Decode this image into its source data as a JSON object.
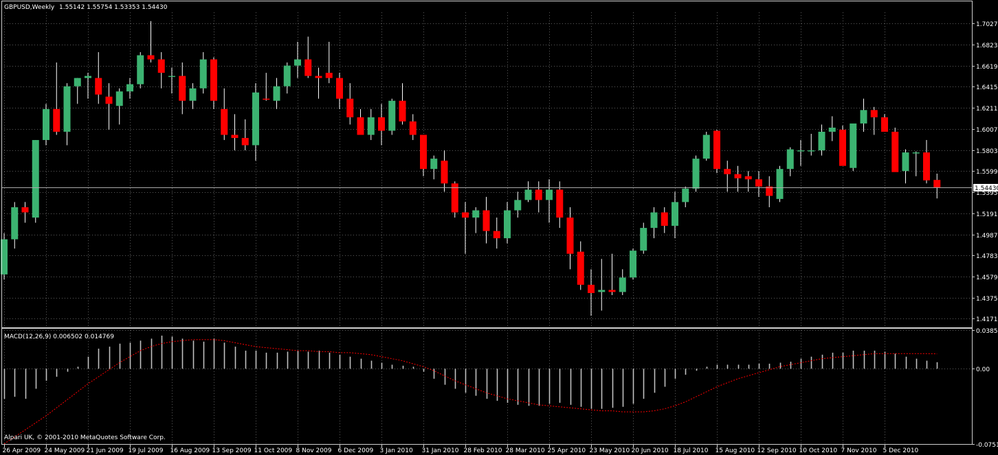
{
  "header": {
    "symbol_label": "GBPUSD,Weekly",
    "ohlc_label": "1.55142 1.55754 1.53353 1.54430"
  },
  "macd_panel": {
    "label": "MACD(12,26,9) 0.006502 0.014769"
  },
  "footer": {
    "broker_label": "Alpari UK, © 2001-2010 MetaQuotes Software Corp."
  },
  "colors": {
    "background": "#000000",
    "grid": "#5c5c5c",
    "bull_candle": "#3cb371",
    "bear_candle": "#ff0000",
    "wick": "#ffffff",
    "histogram": "#c0c0c0",
    "signal_line": "#ff0000",
    "last_price_line": "#aaaaaa"
  },
  "chart_data": [
    {
      "type": "candlestick",
      "symbol": "GBPUSD",
      "timeframe": "Weekly",
      "current_price": 1.5443,
      "current_price_label": "1.54430",
      "ylim": [
        1.4088,
        1.7135
      ],
      "y_ticks": [
        "1.70270",
        "1.68230",
        "1.66190",
        "1.64150",
        "1.62110",
        "1.60070",
        "1.58030",
        "1.55990",
        "1.53950",
        "1.51910",
        "1.49870",
        "1.47830",
        "1.45790",
        "1.43750",
        "1.41710"
      ],
      "x_ticks": [
        {
          "index": 0,
          "label": "26 Apr 2009"
        },
        {
          "index": 4,
          "label": "24 May 2009"
        },
        {
          "index": 8,
          "label": "21 Jun 2009"
        },
        {
          "index": 12,
          "label": "19 Jul 2009"
        },
        {
          "index": 16,
          "label": "16 Aug 2009"
        },
        {
          "index": 20,
          "label": "13 Sep 2009"
        },
        {
          "index": 24,
          "label": "11 Oct 2009"
        },
        {
          "index": 28,
          "label": "8 Nov 2009"
        },
        {
          "index": 32,
          "label": "6 Dec 2009"
        },
        {
          "index": 36,
          "label": "3 Jan 2010"
        },
        {
          "index": 40,
          "label": "31 Jan 2010"
        },
        {
          "index": 44,
          "label": "28 Feb 2010"
        },
        {
          "index": 48,
          "label": "28 Mar 2010"
        },
        {
          "index": 52,
          "label": "25 Apr 2010"
        },
        {
          "index": 56,
          "label": "23 May 2010"
        },
        {
          "index": 60,
          "label": "20 Jun 2010"
        },
        {
          "index": 64,
          "label": "18 Jul 2010"
        },
        {
          "index": 68,
          "label": "15 Aug 2010"
        },
        {
          "index": 72,
          "label": "12 Sep 2010"
        },
        {
          "index": 76,
          "label": "10 Oct 2010"
        },
        {
          "index": 80,
          "label": "7 Nov 2010"
        },
        {
          "index": 84,
          "label": "5 Dec 2010"
        }
      ],
      "ohlc": [
        [
          1.46,
          1.5,
          1.455,
          1.494
        ],
        [
          1.494,
          1.53,
          1.485,
          1.525
        ],
        [
          1.525,
          1.53,
          1.51,
          1.52
        ],
        [
          1.515,
          1.59,
          1.51,
          1.59
        ],
        [
          1.59,
          1.625,
          1.585,
          1.62
        ],
        [
          1.62,
          1.665,
          1.595,
          1.598
        ],
        [
          1.598,
          1.645,
          1.585,
          1.642
        ],
        [
          1.642,
          1.65,
          1.625,
          1.65
        ],
        [
          1.65,
          1.655,
          1.63,
          1.652
        ],
        [
          1.65,
          1.675,
          1.625,
          1.634
        ],
        [
          1.632,
          1.645,
          1.6,
          1.625
        ],
        [
          1.623,
          1.64,
          1.605,
          1.637
        ],
        [
          1.637,
          1.65,
          1.63,
          1.644
        ],
        [
          1.644,
          1.675,
          1.64,
          1.672
        ],
        [
          1.672,
          1.705,
          1.665,
          1.668
        ],
        [
          1.668,
          1.675,
          1.64,
          1.655
        ],
        [
          1.652,
          1.66,
          1.635,
          1.652
        ],
        [
          1.652,
          1.665,
          1.615,
          1.628
        ],
        [
          1.628,
          1.645,
          1.62,
          1.64
        ],
        [
          1.64,
          1.675,
          1.635,
          1.668
        ],
        [
          1.668,
          1.67,
          1.62,
          1.628
        ],
        [
          1.62,
          1.64,
          1.59,
          1.595
        ],
        [
          1.595,
          1.615,
          1.58,
          1.592
        ],
        [
          1.592,
          1.61,
          1.58,
          1.585
        ],
        [
          1.585,
          1.645,
          1.57,
          1.636
        ],
        [
          1.63,
          1.655,
          1.628,
          1.629
        ],
        [
          1.628,
          1.65,
          1.62,
          1.642
        ],
        [
          1.642,
          1.665,
          1.635,
          1.662
        ],
        [
          1.662,
          1.685,
          1.65,
          1.668
        ],
        [
          1.668,
          1.69,
          1.65,
          1.652
        ],
        [
          1.652,
          1.66,
          1.63,
          1.65
        ],
        [
          1.655,
          1.685,
          1.645,
          1.65
        ],
        [
          1.65,
          1.655,
          1.62,
          1.63
        ],
        [
          1.63,
          1.645,
          1.605,
          1.612
        ],
        [
          1.612,
          1.62,
          1.595,
          1.595
        ],
        [
          1.595,
          1.62,
          1.59,
          1.612
        ],
        [
          1.612,
          1.625,
          1.585,
          1.599
        ],
        [
          1.599,
          1.63,
          1.595,
          1.628
        ],
        [
          1.628,
          1.645,
          1.605,
          1.608
        ],
        [
          1.608,
          1.615,
          1.59,
          1.595
        ],
        [
          1.595,
          1.595,
          1.555,
          1.562
        ],
        [
          1.562,
          1.575,
          1.552,
          1.572
        ],
        [
          1.57,
          1.58,
          1.54,
          1.548
        ],
        [
          1.548,
          1.55,
          1.515,
          1.52
        ],
        [
          1.52,
          1.53,
          1.48,
          1.515
        ],
        [
          1.515,
          1.525,
          1.5,
          1.522
        ],
        [
          1.522,
          1.535,
          1.49,
          1.502
        ],
        [
          1.502,
          1.515,
          1.485,
          1.495
        ],
        [
          1.495,
          1.53,
          1.49,
          1.522
        ],
        [
          1.522,
          1.54,
          1.515,
          1.532
        ],
        [
          1.532,
          1.55,
          1.53,
          1.542
        ],
        [
          1.542,
          1.55,
          1.52,
          1.532
        ],
        [
          1.532,
          1.552,
          1.51,
          1.542
        ],
        [
          1.542,
          1.55,
          1.505,
          1.515
        ],
        [
          1.515,
          1.525,
          1.465,
          1.48
        ],
        [
          1.482,
          1.492,
          1.445,
          1.45
        ],
        [
          1.45,
          1.465,
          1.42,
          1.442
        ],
        [
          1.443,
          1.475,
          1.425,
          1.445
        ],
        [
          1.445,
          1.48,
          1.44,
          1.443
        ],
        [
          1.443,
          1.465,
          1.44,
          1.457
        ],
        [
          1.457,
          1.485,
          1.455,
          1.483
        ],
        [
          1.483,
          1.51,
          1.48,
          1.505
        ],
        [
          1.505,
          1.525,
          1.495,
          1.52
        ],
        [
          1.52,
          1.525,
          1.5,
          1.507
        ],
        [
          1.507,
          1.54,
          1.495,
          1.53
        ],
        [
          1.53,
          1.545,
          1.525,
          1.543
        ],
        [
          1.543,
          1.575,
          1.54,
          1.572
        ],
        [
          1.572,
          1.598,
          1.57,
          1.595
        ],
        [
          1.599,
          1.6,
          1.558,
          1.562
        ],
        [
          1.562,
          1.57,
          1.54,
          1.557
        ],
        [
          1.557,
          1.565,
          1.54,
          1.553
        ],
        [
          1.555,
          1.56,
          1.54,
          1.552
        ],
        [
          1.552,
          1.56,
          1.535,
          1.545
        ],
        [
          1.545,
          1.555,
          1.525,
          1.536
        ],
        [
          1.533,
          1.565,
          1.53,
          1.562
        ],
        [
          1.562,
          1.583,
          1.555,
          1.581
        ],
        [
          1.58,
          1.59,
          1.565,
          1.58
        ],
        [
          1.58,
          1.596,
          1.575,
          1.58
        ],
        [
          1.58,
          1.605,
          1.575,
          1.598
        ],
        [
          1.598,
          1.613,
          1.589,
          1.602
        ],
        [
          1.6,
          1.604,
          1.58,
          1.565
        ],
        [
          1.563,
          1.592,
          1.56,
          1.606
        ],
        [
          1.606,
          1.63,
          1.598,
          1.619
        ],
        [
          1.619,
          1.622,
          1.595,
          1.612
        ],
        [
          1.612,
          1.615,
          1.598,
          1.598
        ],
        [
          1.598,
          1.602,
          1.58,
          1.559
        ],
        [
          1.56,
          1.581,
          1.548,
          1.578
        ],
        [
          1.578,
          1.579,
          1.555,
          1.578
        ],
        [
          1.578,
          1.59,
          1.548,
          1.551
        ],
        [
          1.5514,
          1.5575,
          1.5335,
          1.5443
        ]
      ]
    },
    {
      "type": "bar",
      "name": "MACD(12,26,9)",
      "macd_value": 0.006502,
      "signal_value": 0.014769,
      "ylim": [
        -0.07511,
        0.03851
      ],
      "y_ticks": [
        "0.03851",
        "0.00",
        "-0.07511"
      ],
      "histogram": [
        -0.03,
        -0.028,
        -0.03,
        -0.02,
        -0.012,
        -0.008,
        -0.003,
        0.002,
        0.012,
        0.02,
        0.022,
        0.025,
        0.026,
        0.028,
        0.03,
        0.033,
        0.032,
        0.03,
        0.028,
        0.027,
        0.03,
        0.026,
        0.022,
        0.018,
        0.018,
        0.016,
        0.016,
        0.017,
        0.018,
        0.017,
        0.018,
        0.016,
        0.014,
        0.012,
        0.01,
        0.008,
        0.006,
        0.004,
        0.003,
        0.002,
        -0.003,
        -0.01,
        -0.016,
        -0.02,
        -0.024,
        -0.027,
        -0.03,
        -0.032,
        -0.034,
        -0.036,
        -0.037,
        -0.037,
        -0.035,
        -0.034,
        -0.036,
        -0.038,
        -0.04,
        -0.04,
        -0.039,
        -0.038,
        -0.035,
        -0.03,
        -0.024,
        -0.018,
        -0.01,
        -0.006,
        -0.002,
        0.002,
        0.004,
        0.004,
        0.004,
        0.004,
        0.005,
        0.005,
        0.006,
        0.007,
        0.01,
        0.012,
        0.014,
        0.016,
        0.016,
        0.018,
        0.018,
        0.018,
        0.017,
        0.015,
        0.012,
        0.01,
        0.008,
        0.0065
      ],
      "signal": [
        -0.075,
        -0.068,
        -0.061,
        -0.054,
        -0.047,
        -0.039,
        -0.031,
        -0.023,
        -0.015,
        -0.008,
        -0.001,
        0.006,
        0.012,
        0.018,
        0.022,
        0.025,
        0.027,
        0.028,
        0.029,
        0.029,
        0.029,
        0.028,
        0.026,
        0.024,
        0.022,
        0.021,
        0.02,
        0.019,
        0.018,
        0.018,
        0.017,
        0.017,
        0.016,
        0.016,
        0.015,
        0.014,
        0.012,
        0.01,
        0.008,
        0.005,
        0.002,
        -0.002,
        -0.007,
        -0.012,
        -0.016,
        -0.02,
        -0.024,
        -0.027,
        -0.03,
        -0.032,
        -0.034,
        -0.036,
        -0.037,
        -0.038,
        -0.039,
        -0.04,
        -0.041,
        -0.042,
        -0.042,
        -0.043,
        -0.043,
        -0.043,
        -0.042,
        -0.04,
        -0.037,
        -0.033,
        -0.028,
        -0.023,
        -0.018,
        -0.014,
        -0.01,
        -0.007,
        -0.004,
        -0.001,
        0.002,
        0.004,
        0.006,
        0.008,
        0.01,
        0.011,
        0.012,
        0.013,
        0.014,
        0.015,
        0.015,
        0.015,
        0.015,
        0.015,
        0.015,
        0.0148
      ]
    }
  ]
}
